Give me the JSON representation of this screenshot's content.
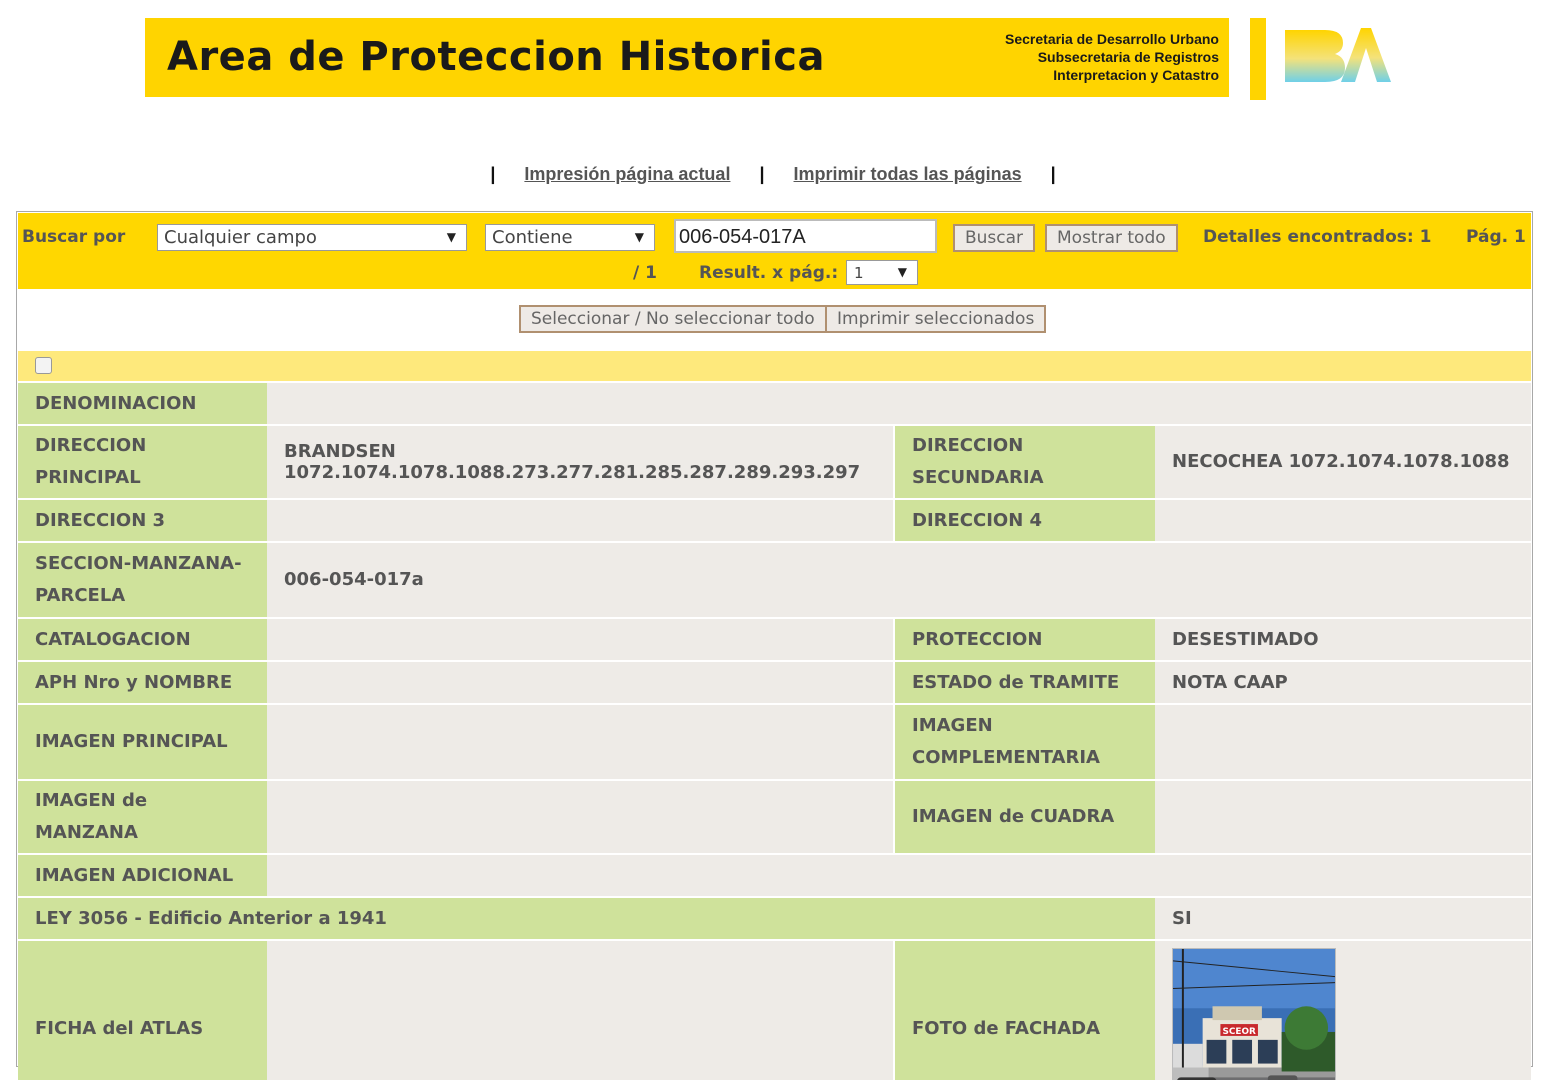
{
  "header": {
    "title": "Area de Proteccion Historica",
    "sub1": "Secretaria de Desarrollo Urbano",
    "sub2": "Subsecretaria de Registros",
    "sub3": "Interpretacion y Catastro"
  },
  "print_links": {
    "current": "Impresión página actual",
    "all": "Imprimir todas las páginas"
  },
  "search": {
    "label": "Buscar por",
    "field": "Cualquier campo",
    "operator": "Contiene",
    "value": "006-054-017A",
    "buscar": "Buscar",
    "mostrar": "Mostrar todo",
    "found": "Detalles encontrados: 1",
    "page": "Pág. 1",
    "page_total": "/ 1",
    "per_page_label": "Result. x pág.:",
    "per_page": "1"
  },
  "actions": {
    "select_all": "Seleccionar / No seleccionar todo",
    "print_selected": "Imprimir seleccionados"
  },
  "record": {
    "denominacion_label": "DENOMINACION",
    "denominacion": "",
    "dir_principal_label": "DIRECCION PRINCIPAL",
    "dir_principal_1": "BRANDSEN",
    "dir_principal_2": "1072.1074.1078.1088.273.277.281.285.287.289.293.297",
    "dir_secundaria_label": "DIRECCION SECUNDARIA",
    "dir_secundaria": "NECOCHEA 1072.1074.1078.1088",
    "dir3_label": "DIRECCION 3",
    "dir3": "",
    "dir4_label": "DIRECCION 4",
    "dir4": "",
    "smp_label": "SECCION-MANZANA-PARCELA",
    "smp": "006-054-017a",
    "catalogacion_label": "CATALOGACION",
    "catalogacion": "",
    "proteccion_label": "PROTECCION",
    "proteccion": "DESESTIMADO",
    "aph_label": "APH Nro y NOMBRE",
    "aph": "",
    "estado_label": "ESTADO de TRAMITE",
    "estado": "NOTA CAAP",
    "img_principal_label": "IMAGEN PRINCIPAL",
    "img_principal": "",
    "img_complementaria_label": "IMAGEN COMPLEMENTARIA",
    "img_complementaria": "",
    "img_manzana_label": "IMAGEN de MANZANA",
    "img_manzana": "",
    "img_cuadra_label": "IMAGEN de CUADRA",
    "img_cuadra": "",
    "img_adicional_label": "IMAGEN ADICIONAL",
    "img_adicional": "",
    "ley_label": "LEY 3056 - Edificio Anterior a 1941",
    "ley": "SI",
    "ficha_label": "FICHA del ATLAS",
    "ficha": "",
    "foto_label": "FOTO de FACHADA",
    "foto_sign": "SCEOR"
  },
  "colors": {
    "banner": "#ffd400",
    "label_cell": "#cfe29b",
    "value_cell": "#eeebe7",
    "check_row": "#fee97c"
  }
}
